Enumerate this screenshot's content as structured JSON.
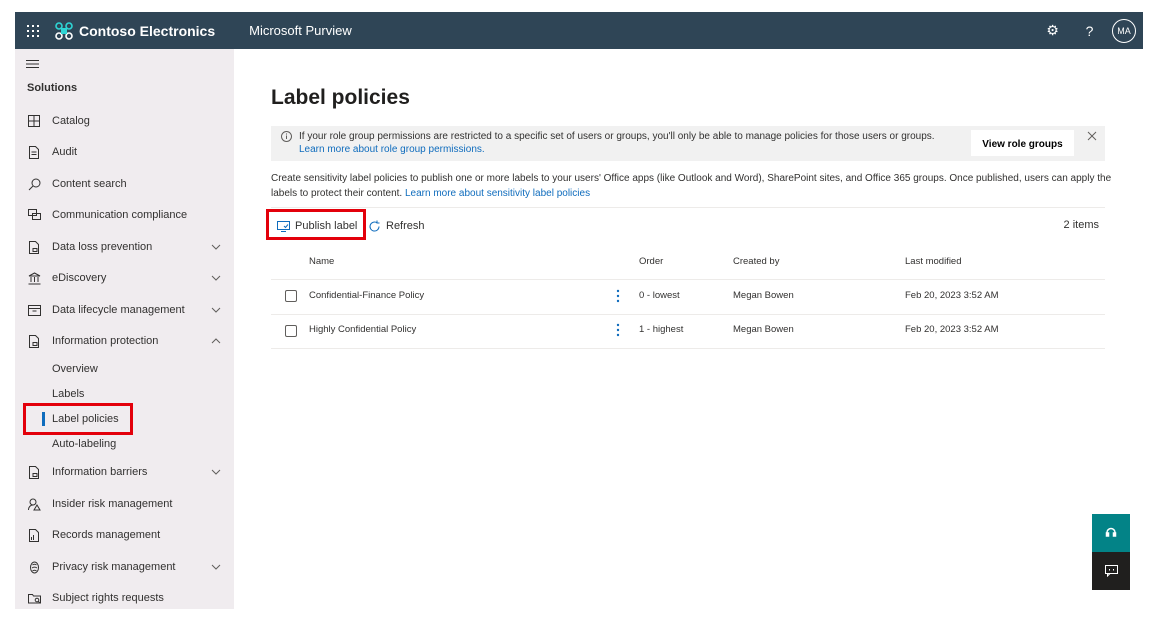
{
  "header": {
    "org_name": "Contoso Electronics",
    "product_name": "Microsoft Purview",
    "avatar_initials": "MA",
    "icons": [
      "waffle-icon",
      "contoso-logo-icon",
      "gear-icon",
      "help-icon"
    ]
  },
  "sidebar": {
    "heading": "Solutions",
    "items": [
      {
        "label": "Catalog",
        "icon": "catalog-icon",
        "expandable": false
      },
      {
        "label": "Audit",
        "icon": "audit-icon",
        "expandable": false
      },
      {
        "label": "Content search",
        "icon": "search-icon",
        "expandable": false
      },
      {
        "label": "Communication compliance",
        "icon": "communication-icon",
        "expandable": false
      },
      {
        "label": "Data loss prevention",
        "icon": "data-loss-icon",
        "expandable": true,
        "expanded": false
      },
      {
        "label": "eDiscovery",
        "icon": "ediscovery-icon",
        "expandable": true,
        "expanded": false
      },
      {
        "label": "Data lifecycle management",
        "icon": "archive-icon",
        "expandable": true,
        "expanded": false
      },
      {
        "label": "Information protection",
        "icon": "info-protection-icon",
        "expandable": true,
        "expanded": true
      },
      {
        "label": "Information barriers",
        "icon": "info-barriers-icon",
        "expandable": true,
        "expanded": false
      },
      {
        "label": "Insider risk management",
        "icon": "insider-risk-icon",
        "expandable": false
      },
      {
        "label": "Records management",
        "icon": "records-icon",
        "expandable": false
      },
      {
        "label": "Privacy risk management",
        "icon": "privacy-icon",
        "expandable": true,
        "expanded": false
      },
      {
        "label": "Subject rights requests",
        "icon": "subject-rights-icon",
        "expandable": false
      }
    ],
    "sub_items": [
      {
        "label": "Overview",
        "active": false
      },
      {
        "label": "Labels",
        "active": false
      },
      {
        "label": "Label policies",
        "active": true
      },
      {
        "label": "Auto-labeling",
        "active": false
      }
    ]
  },
  "main": {
    "title": "Label policies",
    "banner": {
      "text": "If your role group permissions are restricted to a specific set of users or groups, you'll only be able to manage policies for those users or groups.",
      "link": "Learn more about role group permissions.",
      "button": "View role groups"
    },
    "description": {
      "text": "Create sensitivity label policies to publish one or more labels to your users' Office apps (like Outlook and Word), SharePoint sites, and Office 365 groups. Once published, users can apply the labels to protect their content.",
      "link": "Learn more about sensitivity label policies"
    },
    "commands": {
      "publish": "Publish label",
      "refresh": "Refresh"
    },
    "item_count": "2 items",
    "table": {
      "columns": [
        "Name",
        "Order",
        "Created by",
        "Last modified"
      ],
      "rows": [
        {
          "name": "Confidential-Finance Policy",
          "order": "0 - lowest",
          "created_by": "Megan Bowen",
          "last_modified": "Feb 20, 2023 3:52 AM"
        },
        {
          "name": "Highly Confidential Policy",
          "order": "1 - highest",
          "created_by": "Megan Bowen",
          "last_modified": "Feb 20, 2023 3:52 AM"
        }
      ]
    }
  },
  "colors": {
    "topbar": "#2f4556",
    "sidebar": "#f0ecef",
    "accent": "#0f6cbd",
    "highlight": "#e3000b",
    "support": "#038387",
    "feedback": "#201f1e"
  }
}
